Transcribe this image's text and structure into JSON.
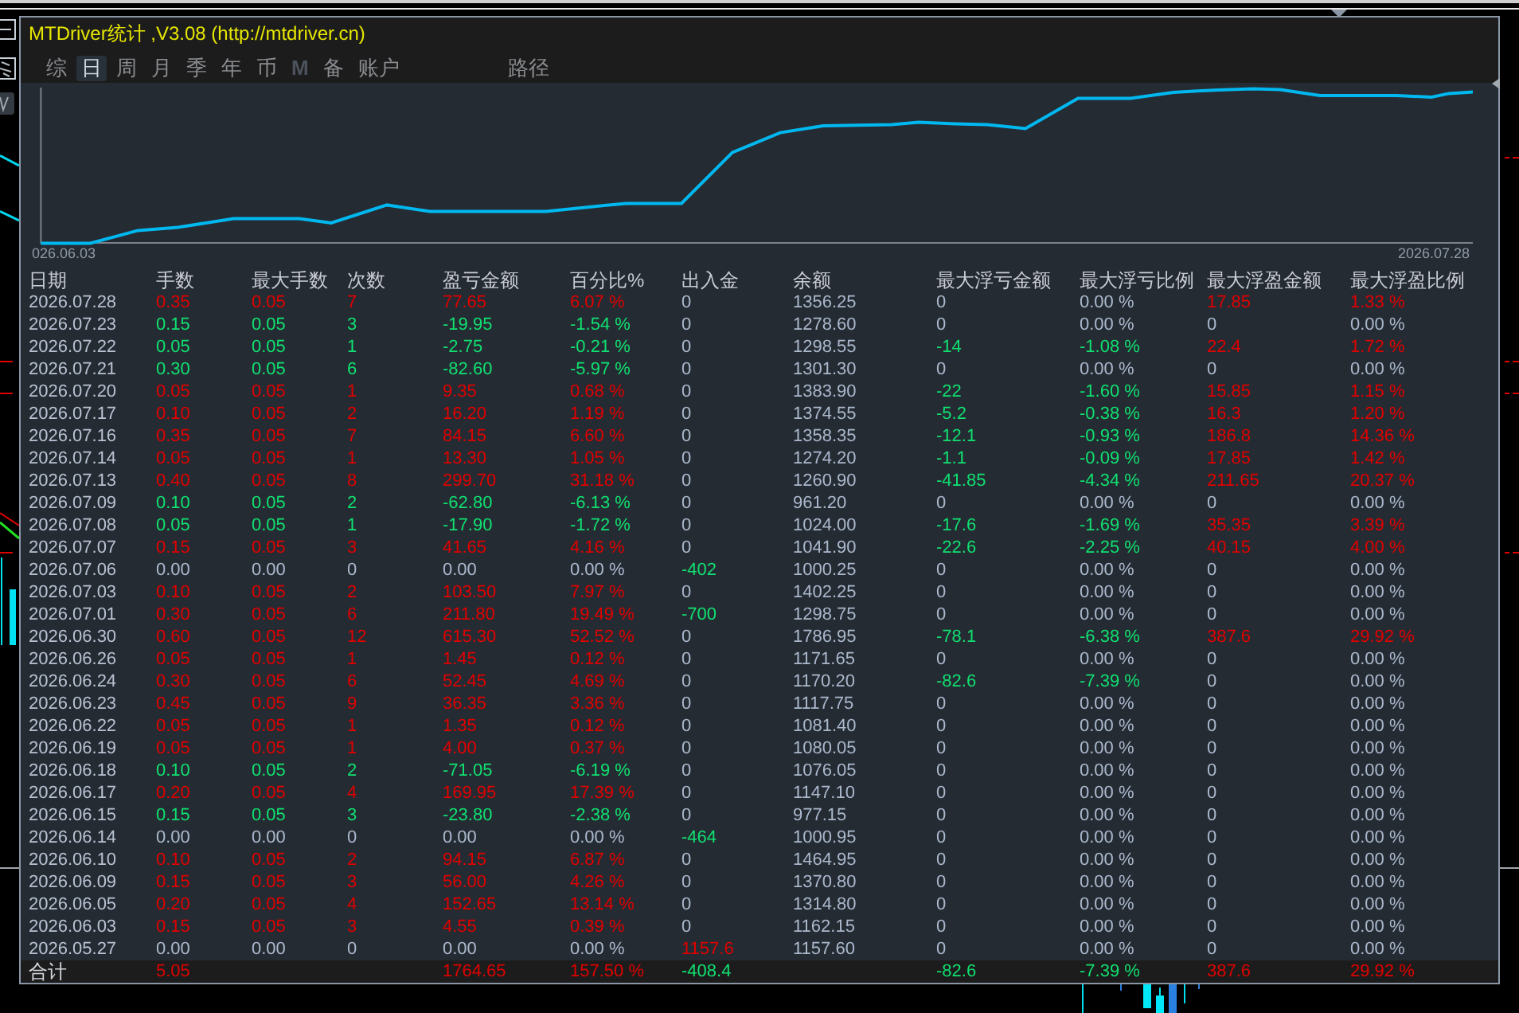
{
  "window": {
    "title": "MTDriver统计 ,V3.08 (http://mtdriver.cn)"
  },
  "tabs": [
    {
      "label": "综",
      "selected": false,
      "disabled": false
    },
    {
      "label": "日",
      "selected": true,
      "disabled": false
    },
    {
      "label": "周",
      "selected": false,
      "disabled": false
    },
    {
      "label": "月",
      "selected": false,
      "disabled": false
    },
    {
      "label": "季",
      "selected": false,
      "disabled": false
    },
    {
      "label": "年",
      "selected": false,
      "disabled": false
    },
    {
      "label": "币",
      "selected": false,
      "disabled": false
    },
    {
      "label": "M",
      "selected": false,
      "disabled": true
    },
    {
      "label": "备",
      "selected": false,
      "disabled": false
    },
    {
      "label": "账户",
      "selected": false,
      "disabled": false
    }
  ],
  "path_tab": {
    "label": "路径"
  },
  "chart": {
    "x_start_label": "026.06.03",
    "x_end_label": "2026.07.28"
  },
  "table": {
    "columns": [
      "日期",
      "手数",
      "最大手数",
      "次数",
      "盈亏金额",
      "百分比%",
      "出入金",
      "余额",
      "最大浮亏金额",
      "最大浮亏比例",
      "最大浮盈金额",
      "最大浮盈比例"
    ],
    "rows": [
      {
        "cells": [
          {
            "text": "2026.07.28",
            "color": "#b8c2d2"
          },
          {
            "text": "0.35",
            "color": "#e00000"
          },
          {
            "text": "0.05",
            "color": "#e00000"
          },
          {
            "text": "7",
            "color": "#e00000"
          },
          {
            "text": "77.65",
            "color": "#e00000"
          },
          {
            "text": "6.07 %",
            "color": "#e00000"
          },
          {
            "text": "0",
            "color": "#aab8cc"
          },
          {
            "text": "1356.25",
            "color": "#aab8cc"
          },
          {
            "text": "0",
            "color": "#aab8cc"
          },
          {
            "text": "0.00 %",
            "color": "#aab8cc"
          },
          {
            "text": "17.85",
            "color": "#e00000"
          },
          {
            "text": "1.33 %",
            "color": "#e00000"
          }
        ]
      },
      {
        "cells": [
          {
            "text": "2026.07.23",
            "color": "#b8c2d2"
          },
          {
            "text": "0.15",
            "color": "#10e070"
          },
          {
            "text": "0.05",
            "color": "#10e070"
          },
          {
            "text": "3",
            "color": "#10e070"
          },
          {
            "text": "-19.95",
            "color": "#10e070"
          },
          {
            "text": "-1.54 %",
            "color": "#10e070"
          },
          {
            "text": "0",
            "color": "#aab8cc"
          },
          {
            "text": "1278.60",
            "color": "#aab8cc"
          },
          {
            "text": "0",
            "color": "#aab8cc"
          },
          {
            "text": "0.00 %",
            "color": "#aab8cc"
          },
          {
            "text": "0",
            "color": "#aab8cc"
          },
          {
            "text": "0.00 %",
            "color": "#aab8cc"
          }
        ]
      },
      {
        "cells": [
          {
            "text": "2026.07.22",
            "color": "#b8c2d2"
          },
          {
            "text": "0.05",
            "color": "#10e070"
          },
          {
            "text": "0.05",
            "color": "#10e070"
          },
          {
            "text": "1",
            "color": "#10e070"
          },
          {
            "text": "-2.75",
            "color": "#10e070"
          },
          {
            "text": "-0.21 %",
            "color": "#10e070"
          },
          {
            "text": "0",
            "color": "#aab8cc"
          },
          {
            "text": "1298.55",
            "color": "#aab8cc"
          },
          {
            "text": "-14",
            "color": "#10e070"
          },
          {
            "text": "-1.08 %",
            "color": "#10e070"
          },
          {
            "text": "22.4",
            "color": "#e00000"
          },
          {
            "text": "1.72 %",
            "color": "#e00000"
          }
        ]
      },
      {
        "cells": [
          {
            "text": "2026.07.21",
            "color": "#b8c2d2"
          },
          {
            "text": "0.30",
            "color": "#10e070"
          },
          {
            "text": "0.05",
            "color": "#10e070"
          },
          {
            "text": "6",
            "color": "#10e070"
          },
          {
            "text": "-82.60",
            "color": "#10e070"
          },
          {
            "text": "-5.97 %",
            "color": "#10e070"
          },
          {
            "text": "0",
            "color": "#aab8cc"
          },
          {
            "text": "1301.30",
            "color": "#aab8cc"
          },
          {
            "text": "0",
            "color": "#aab8cc"
          },
          {
            "text": "0.00 %",
            "color": "#aab8cc"
          },
          {
            "text": "0",
            "color": "#aab8cc"
          },
          {
            "text": "0.00 %",
            "color": "#aab8cc"
          }
        ]
      },
      {
        "cells": [
          {
            "text": "2026.07.20",
            "color": "#b8c2d2"
          },
          {
            "text": "0.05",
            "color": "#e00000"
          },
          {
            "text": "0.05",
            "color": "#e00000"
          },
          {
            "text": "1",
            "color": "#e00000"
          },
          {
            "text": "9.35",
            "color": "#e00000"
          },
          {
            "text": "0.68 %",
            "color": "#e00000"
          },
          {
            "text": "0",
            "color": "#aab8cc"
          },
          {
            "text": "1383.90",
            "color": "#aab8cc"
          },
          {
            "text": "-22",
            "color": "#10e070"
          },
          {
            "text": "-1.60 %",
            "color": "#10e070"
          },
          {
            "text": "15.85",
            "color": "#e00000"
          },
          {
            "text": "1.15 %",
            "color": "#e00000"
          }
        ]
      },
      {
        "cells": [
          {
            "text": "2026.07.17",
            "color": "#b8c2d2"
          },
          {
            "text": "0.10",
            "color": "#e00000"
          },
          {
            "text": "0.05",
            "color": "#e00000"
          },
          {
            "text": "2",
            "color": "#e00000"
          },
          {
            "text": "16.20",
            "color": "#e00000"
          },
          {
            "text": "1.19 %",
            "color": "#e00000"
          },
          {
            "text": "0",
            "color": "#aab8cc"
          },
          {
            "text": "1374.55",
            "color": "#aab8cc"
          },
          {
            "text": "-5.2",
            "color": "#10e070"
          },
          {
            "text": "-0.38 %",
            "color": "#10e070"
          },
          {
            "text": "16.3",
            "color": "#e00000"
          },
          {
            "text": "1.20 %",
            "color": "#e00000"
          }
        ]
      },
      {
        "cells": [
          {
            "text": "2026.07.16",
            "color": "#b8c2d2"
          },
          {
            "text": "0.35",
            "color": "#e00000"
          },
          {
            "text": "0.05",
            "color": "#e00000"
          },
          {
            "text": "7",
            "color": "#e00000"
          },
          {
            "text": "84.15",
            "color": "#e00000"
          },
          {
            "text": "6.60 %",
            "color": "#e00000"
          },
          {
            "text": "0",
            "color": "#aab8cc"
          },
          {
            "text": "1358.35",
            "color": "#aab8cc"
          },
          {
            "text": "-12.1",
            "color": "#10e070"
          },
          {
            "text": "-0.93 %",
            "color": "#10e070"
          },
          {
            "text": "186.8",
            "color": "#e00000"
          },
          {
            "text": "14.36 %",
            "color": "#e00000"
          }
        ]
      },
      {
        "cells": [
          {
            "text": "2026.07.14",
            "color": "#b8c2d2"
          },
          {
            "text": "0.05",
            "color": "#e00000"
          },
          {
            "text": "0.05",
            "color": "#e00000"
          },
          {
            "text": "1",
            "color": "#e00000"
          },
          {
            "text": "13.30",
            "color": "#e00000"
          },
          {
            "text": "1.05 %",
            "color": "#e00000"
          },
          {
            "text": "0",
            "color": "#aab8cc"
          },
          {
            "text": "1274.20",
            "color": "#aab8cc"
          },
          {
            "text": "-1.1",
            "color": "#10e070"
          },
          {
            "text": "-0.09 %",
            "color": "#10e070"
          },
          {
            "text": "17.85",
            "color": "#e00000"
          },
          {
            "text": "1.42 %",
            "color": "#e00000"
          }
        ]
      },
      {
        "cells": [
          {
            "text": "2026.07.13",
            "color": "#b8c2d2"
          },
          {
            "text": "0.40",
            "color": "#e00000"
          },
          {
            "text": "0.05",
            "color": "#e00000"
          },
          {
            "text": "8",
            "color": "#e00000"
          },
          {
            "text": "299.70",
            "color": "#e00000"
          },
          {
            "text": "31.18 %",
            "color": "#e00000"
          },
          {
            "text": "0",
            "color": "#aab8cc"
          },
          {
            "text": "1260.90",
            "color": "#aab8cc"
          },
          {
            "text": "-41.85",
            "color": "#10e070"
          },
          {
            "text": "-4.34 %",
            "color": "#10e070"
          },
          {
            "text": "211.65",
            "color": "#e00000"
          },
          {
            "text": "20.37 %",
            "color": "#e00000"
          }
        ]
      },
      {
        "cells": [
          {
            "text": "2026.07.09",
            "color": "#b8c2d2"
          },
          {
            "text": "0.10",
            "color": "#10e070"
          },
          {
            "text": "0.05",
            "color": "#10e070"
          },
          {
            "text": "2",
            "color": "#10e070"
          },
          {
            "text": "-62.80",
            "color": "#10e070"
          },
          {
            "text": "-6.13 %",
            "color": "#10e070"
          },
          {
            "text": "0",
            "color": "#aab8cc"
          },
          {
            "text": "961.20",
            "color": "#aab8cc"
          },
          {
            "text": "0",
            "color": "#aab8cc"
          },
          {
            "text": "0.00 %",
            "color": "#aab8cc"
          },
          {
            "text": "0",
            "color": "#aab8cc"
          },
          {
            "text": "0.00 %",
            "color": "#aab8cc"
          }
        ]
      },
      {
        "cells": [
          {
            "text": "2026.07.08",
            "color": "#b8c2d2"
          },
          {
            "text": "0.05",
            "color": "#10e070"
          },
          {
            "text": "0.05",
            "color": "#10e070"
          },
          {
            "text": "1",
            "color": "#10e070"
          },
          {
            "text": "-17.90",
            "color": "#10e070"
          },
          {
            "text": "-1.72 %",
            "color": "#10e070"
          },
          {
            "text": "0",
            "color": "#aab8cc"
          },
          {
            "text": "1024.00",
            "color": "#aab8cc"
          },
          {
            "text": "-17.6",
            "color": "#10e070"
          },
          {
            "text": "-1.69 %",
            "color": "#10e070"
          },
          {
            "text": "35.35",
            "color": "#e00000"
          },
          {
            "text": "3.39 %",
            "color": "#e00000"
          }
        ]
      },
      {
        "cells": [
          {
            "text": "2026.07.07",
            "color": "#b8c2d2"
          },
          {
            "text": "0.15",
            "color": "#e00000"
          },
          {
            "text": "0.05",
            "color": "#e00000"
          },
          {
            "text": "3",
            "color": "#e00000"
          },
          {
            "text": "41.65",
            "color": "#e00000"
          },
          {
            "text": "4.16 %",
            "color": "#e00000"
          },
          {
            "text": "0",
            "color": "#aab8cc"
          },
          {
            "text": "1041.90",
            "color": "#aab8cc"
          },
          {
            "text": "-22.6",
            "color": "#10e070"
          },
          {
            "text": "-2.25 %",
            "color": "#10e070"
          },
          {
            "text": "40.15",
            "color": "#e00000"
          },
          {
            "text": "4.00 %",
            "color": "#e00000"
          }
        ]
      },
      {
        "cells": [
          {
            "text": "2026.07.06",
            "color": "#b8c2d2"
          },
          {
            "text": "0.00",
            "color": "#aab8cc"
          },
          {
            "text": "0.00",
            "color": "#aab8cc"
          },
          {
            "text": "0",
            "color": "#aab8cc"
          },
          {
            "text": "0.00",
            "color": "#aab8cc"
          },
          {
            "text": "0.00 %",
            "color": "#aab8cc"
          },
          {
            "text": "-402",
            "color": "#10e070"
          },
          {
            "text": "1000.25",
            "color": "#aab8cc"
          },
          {
            "text": "0",
            "color": "#aab8cc"
          },
          {
            "text": "0.00 %",
            "color": "#aab8cc"
          },
          {
            "text": "0",
            "color": "#aab8cc"
          },
          {
            "text": "0.00 %",
            "color": "#aab8cc"
          }
        ]
      },
      {
        "cells": [
          {
            "text": "2026.07.03",
            "color": "#b8c2d2"
          },
          {
            "text": "0.10",
            "color": "#e00000"
          },
          {
            "text": "0.05",
            "color": "#e00000"
          },
          {
            "text": "2",
            "color": "#e00000"
          },
          {
            "text": "103.50",
            "color": "#e00000"
          },
          {
            "text": "7.97 %",
            "color": "#e00000"
          },
          {
            "text": "0",
            "color": "#aab8cc"
          },
          {
            "text": "1402.25",
            "color": "#aab8cc"
          },
          {
            "text": "0",
            "color": "#aab8cc"
          },
          {
            "text": "0.00 %",
            "color": "#aab8cc"
          },
          {
            "text": "0",
            "color": "#aab8cc"
          },
          {
            "text": "0.00 %",
            "color": "#aab8cc"
          }
        ]
      },
      {
        "cells": [
          {
            "text": "2026.07.01",
            "color": "#b8c2d2"
          },
          {
            "text": "0.30",
            "color": "#e00000"
          },
          {
            "text": "0.05",
            "color": "#e00000"
          },
          {
            "text": "6",
            "color": "#e00000"
          },
          {
            "text": "211.80",
            "color": "#e00000"
          },
          {
            "text": "19.49 %",
            "color": "#e00000"
          },
          {
            "text": "-700",
            "color": "#10e070"
          },
          {
            "text": "1298.75",
            "color": "#aab8cc"
          },
          {
            "text": "0",
            "color": "#aab8cc"
          },
          {
            "text": "0.00 %",
            "color": "#aab8cc"
          },
          {
            "text": "0",
            "color": "#aab8cc"
          },
          {
            "text": "0.00 %",
            "color": "#aab8cc"
          }
        ]
      },
      {
        "cells": [
          {
            "text": "2026.06.30",
            "color": "#b8c2d2"
          },
          {
            "text": "0.60",
            "color": "#e00000"
          },
          {
            "text": "0.05",
            "color": "#e00000"
          },
          {
            "text": "12",
            "color": "#e00000"
          },
          {
            "text": "615.30",
            "color": "#e00000"
          },
          {
            "text": "52.52 %",
            "color": "#e00000"
          },
          {
            "text": "0",
            "color": "#aab8cc"
          },
          {
            "text": "1786.95",
            "color": "#aab8cc"
          },
          {
            "text": "-78.1",
            "color": "#10e070"
          },
          {
            "text": "-6.38 %",
            "color": "#10e070"
          },
          {
            "text": "387.6",
            "color": "#e00000"
          },
          {
            "text": "29.92 %",
            "color": "#e00000"
          }
        ]
      },
      {
        "cells": [
          {
            "text": "2026.06.26",
            "color": "#b8c2d2"
          },
          {
            "text": "0.05",
            "color": "#e00000"
          },
          {
            "text": "0.05",
            "color": "#e00000"
          },
          {
            "text": "1",
            "color": "#e00000"
          },
          {
            "text": "1.45",
            "color": "#e00000"
          },
          {
            "text": "0.12 %",
            "color": "#e00000"
          },
          {
            "text": "0",
            "color": "#aab8cc"
          },
          {
            "text": "1171.65",
            "color": "#aab8cc"
          },
          {
            "text": "0",
            "color": "#aab8cc"
          },
          {
            "text": "0.00 %",
            "color": "#aab8cc"
          },
          {
            "text": "0",
            "color": "#aab8cc"
          },
          {
            "text": "0.00 %",
            "color": "#aab8cc"
          }
        ]
      },
      {
        "cells": [
          {
            "text": "2026.06.24",
            "color": "#b8c2d2"
          },
          {
            "text": "0.30",
            "color": "#e00000"
          },
          {
            "text": "0.05",
            "color": "#e00000"
          },
          {
            "text": "6",
            "color": "#e00000"
          },
          {
            "text": "52.45",
            "color": "#e00000"
          },
          {
            "text": "4.69 %",
            "color": "#e00000"
          },
          {
            "text": "0",
            "color": "#aab8cc"
          },
          {
            "text": "1170.20",
            "color": "#aab8cc"
          },
          {
            "text": "-82.6",
            "color": "#10e070"
          },
          {
            "text": "-7.39 %",
            "color": "#10e070"
          },
          {
            "text": "0",
            "color": "#aab8cc"
          },
          {
            "text": "0.00 %",
            "color": "#aab8cc"
          }
        ]
      },
      {
        "cells": [
          {
            "text": "2026.06.23",
            "color": "#b8c2d2"
          },
          {
            "text": "0.45",
            "color": "#e00000"
          },
          {
            "text": "0.05",
            "color": "#e00000"
          },
          {
            "text": "9",
            "color": "#e00000"
          },
          {
            "text": "36.35",
            "color": "#e00000"
          },
          {
            "text": "3.36 %",
            "color": "#e00000"
          },
          {
            "text": "0",
            "color": "#aab8cc"
          },
          {
            "text": "1117.75",
            "color": "#aab8cc"
          },
          {
            "text": "0",
            "color": "#aab8cc"
          },
          {
            "text": "0.00 %",
            "color": "#aab8cc"
          },
          {
            "text": "0",
            "color": "#aab8cc"
          },
          {
            "text": "0.00 %",
            "color": "#aab8cc"
          }
        ]
      },
      {
        "cells": [
          {
            "text": "2026.06.22",
            "color": "#b8c2d2"
          },
          {
            "text": "0.05",
            "color": "#e00000"
          },
          {
            "text": "0.05",
            "color": "#e00000"
          },
          {
            "text": "1",
            "color": "#e00000"
          },
          {
            "text": "1.35",
            "color": "#e00000"
          },
          {
            "text": "0.12 %",
            "color": "#e00000"
          },
          {
            "text": "0",
            "color": "#aab8cc"
          },
          {
            "text": "1081.40",
            "color": "#aab8cc"
          },
          {
            "text": "0",
            "color": "#aab8cc"
          },
          {
            "text": "0.00 %",
            "color": "#aab8cc"
          },
          {
            "text": "0",
            "color": "#aab8cc"
          },
          {
            "text": "0.00 %",
            "color": "#aab8cc"
          }
        ]
      },
      {
        "cells": [
          {
            "text": "2026.06.19",
            "color": "#b8c2d2"
          },
          {
            "text": "0.05",
            "color": "#e00000"
          },
          {
            "text": "0.05",
            "color": "#e00000"
          },
          {
            "text": "1",
            "color": "#e00000"
          },
          {
            "text": "4.00",
            "color": "#e00000"
          },
          {
            "text": "0.37 %",
            "color": "#e00000"
          },
          {
            "text": "0",
            "color": "#aab8cc"
          },
          {
            "text": "1080.05",
            "color": "#aab8cc"
          },
          {
            "text": "0",
            "color": "#aab8cc"
          },
          {
            "text": "0.00 %",
            "color": "#aab8cc"
          },
          {
            "text": "0",
            "color": "#aab8cc"
          },
          {
            "text": "0.00 %",
            "color": "#aab8cc"
          }
        ]
      },
      {
        "cells": [
          {
            "text": "2026.06.18",
            "color": "#b8c2d2"
          },
          {
            "text": "0.10",
            "color": "#10e070"
          },
          {
            "text": "0.05",
            "color": "#10e070"
          },
          {
            "text": "2",
            "color": "#10e070"
          },
          {
            "text": "-71.05",
            "color": "#10e070"
          },
          {
            "text": "-6.19 %",
            "color": "#10e070"
          },
          {
            "text": "0",
            "color": "#aab8cc"
          },
          {
            "text": "1076.05",
            "color": "#aab8cc"
          },
          {
            "text": "0",
            "color": "#aab8cc"
          },
          {
            "text": "0.00 %",
            "color": "#aab8cc"
          },
          {
            "text": "0",
            "color": "#aab8cc"
          },
          {
            "text": "0.00 %",
            "color": "#aab8cc"
          }
        ]
      },
      {
        "cells": [
          {
            "text": "2026.06.17",
            "color": "#b8c2d2"
          },
          {
            "text": "0.20",
            "color": "#e00000"
          },
          {
            "text": "0.05",
            "color": "#e00000"
          },
          {
            "text": "4",
            "color": "#e00000"
          },
          {
            "text": "169.95",
            "color": "#e00000"
          },
          {
            "text": "17.39 %",
            "color": "#e00000"
          },
          {
            "text": "0",
            "color": "#aab8cc"
          },
          {
            "text": "1147.10",
            "color": "#aab8cc"
          },
          {
            "text": "0",
            "color": "#aab8cc"
          },
          {
            "text": "0.00 %",
            "color": "#aab8cc"
          },
          {
            "text": "0",
            "color": "#aab8cc"
          },
          {
            "text": "0.00 %",
            "color": "#aab8cc"
          }
        ]
      },
      {
        "cells": [
          {
            "text": "2026.06.15",
            "color": "#b8c2d2"
          },
          {
            "text": "0.15",
            "color": "#10e070"
          },
          {
            "text": "0.05",
            "color": "#10e070"
          },
          {
            "text": "3",
            "color": "#10e070"
          },
          {
            "text": "-23.80",
            "color": "#10e070"
          },
          {
            "text": "-2.38 %",
            "color": "#10e070"
          },
          {
            "text": "0",
            "color": "#aab8cc"
          },
          {
            "text": "977.15",
            "color": "#aab8cc"
          },
          {
            "text": "0",
            "color": "#aab8cc"
          },
          {
            "text": "0.00 %",
            "color": "#aab8cc"
          },
          {
            "text": "0",
            "color": "#aab8cc"
          },
          {
            "text": "0.00 %",
            "color": "#aab8cc"
          }
        ]
      },
      {
        "cells": [
          {
            "text": "2026.06.14",
            "color": "#b8c2d2"
          },
          {
            "text": "0.00",
            "color": "#aab8cc"
          },
          {
            "text": "0.00",
            "color": "#aab8cc"
          },
          {
            "text": "0",
            "color": "#aab8cc"
          },
          {
            "text": "0.00",
            "color": "#aab8cc"
          },
          {
            "text": "0.00 %",
            "color": "#aab8cc"
          },
          {
            "text": "-464",
            "color": "#10e070"
          },
          {
            "text": "1000.95",
            "color": "#aab8cc"
          },
          {
            "text": "0",
            "color": "#aab8cc"
          },
          {
            "text": "0.00 %",
            "color": "#aab8cc"
          },
          {
            "text": "0",
            "color": "#aab8cc"
          },
          {
            "text": "0.00 %",
            "color": "#aab8cc"
          }
        ]
      },
      {
        "cells": [
          {
            "text": "2026.06.10",
            "color": "#b8c2d2"
          },
          {
            "text": "0.10",
            "color": "#e00000"
          },
          {
            "text": "0.05",
            "color": "#e00000"
          },
          {
            "text": "2",
            "color": "#e00000"
          },
          {
            "text": "94.15",
            "color": "#e00000"
          },
          {
            "text": "6.87 %",
            "color": "#e00000"
          },
          {
            "text": "0",
            "color": "#aab8cc"
          },
          {
            "text": "1464.95",
            "color": "#aab8cc"
          },
          {
            "text": "0",
            "color": "#aab8cc"
          },
          {
            "text": "0.00 %",
            "color": "#aab8cc"
          },
          {
            "text": "0",
            "color": "#aab8cc"
          },
          {
            "text": "0.00 %",
            "color": "#aab8cc"
          }
        ]
      },
      {
        "cells": [
          {
            "text": "2026.06.09",
            "color": "#b8c2d2"
          },
          {
            "text": "0.15",
            "color": "#e00000"
          },
          {
            "text": "0.05",
            "color": "#e00000"
          },
          {
            "text": "3",
            "color": "#e00000"
          },
          {
            "text": "56.00",
            "color": "#e00000"
          },
          {
            "text": "4.26 %",
            "color": "#e00000"
          },
          {
            "text": "0",
            "color": "#aab8cc"
          },
          {
            "text": "1370.80",
            "color": "#aab8cc"
          },
          {
            "text": "0",
            "color": "#aab8cc"
          },
          {
            "text": "0.00 %",
            "color": "#aab8cc"
          },
          {
            "text": "0",
            "color": "#aab8cc"
          },
          {
            "text": "0.00 %",
            "color": "#aab8cc"
          }
        ]
      },
      {
        "cells": [
          {
            "text": "2026.06.05",
            "color": "#b8c2d2"
          },
          {
            "text": "0.20",
            "color": "#e00000"
          },
          {
            "text": "0.05",
            "color": "#e00000"
          },
          {
            "text": "4",
            "color": "#e00000"
          },
          {
            "text": "152.65",
            "color": "#e00000"
          },
          {
            "text": "13.14 %",
            "color": "#e00000"
          },
          {
            "text": "0",
            "color": "#aab8cc"
          },
          {
            "text": "1314.80",
            "color": "#aab8cc"
          },
          {
            "text": "0",
            "color": "#aab8cc"
          },
          {
            "text": "0.00 %",
            "color": "#aab8cc"
          },
          {
            "text": "0",
            "color": "#aab8cc"
          },
          {
            "text": "0.00 %",
            "color": "#aab8cc"
          }
        ]
      },
      {
        "cells": [
          {
            "text": "2026.06.03",
            "color": "#b8c2d2"
          },
          {
            "text": "0.15",
            "color": "#e00000"
          },
          {
            "text": "0.05",
            "color": "#e00000"
          },
          {
            "text": "3",
            "color": "#e00000"
          },
          {
            "text": "4.55",
            "color": "#e00000"
          },
          {
            "text": "0.39 %",
            "color": "#e00000"
          },
          {
            "text": "0",
            "color": "#aab8cc"
          },
          {
            "text": "1162.15",
            "color": "#aab8cc"
          },
          {
            "text": "0",
            "color": "#aab8cc"
          },
          {
            "text": "0.00 %",
            "color": "#aab8cc"
          },
          {
            "text": "0",
            "color": "#aab8cc"
          },
          {
            "text": "0.00 %",
            "color": "#aab8cc"
          }
        ]
      },
      {
        "cells": [
          {
            "text": "2026.05.27",
            "color": "#b8c2d2"
          },
          {
            "text": "0.00",
            "color": "#aab8cc"
          },
          {
            "text": "0.00",
            "color": "#aab8cc"
          },
          {
            "text": "0",
            "color": "#aab8cc"
          },
          {
            "text": "0.00",
            "color": "#aab8cc"
          },
          {
            "text": "0.00 %",
            "color": "#aab8cc"
          },
          {
            "text": "1157.6",
            "color": "#e00000"
          },
          {
            "text": "1157.60",
            "color": "#aab8cc"
          },
          {
            "text": "0",
            "color": "#aab8cc"
          },
          {
            "text": "0.00 %",
            "color": "#aab8cc"
          },
          {
            "text": "0",
            "color": "#aab8cc"
          },
          {
            "text": "0.00 %",
            "color": "#aab8cc"
          }
        ]
      }
    ],
    "totals": {
      "cells": [
        {
          "text": "合计",
          "color": "#d4d8dc"
        },
        {
          "text": "5.05",
          "color": "#e00000"
        },
        null,
        null,
        {
          "text": "1764.65",
          "color": "#e00000"
        },
        {
          "text": "157.50 %",
          "color": "#e00000"
        },
        {
          "text": "-408.4",
          "color": "#10e070"
        },
        null,
        {
          "text": "-82.6",
          "color": "#10e070"
        },
        {
          "text": "-7.39 %",
          "color": "#10e070"
        },
        {
          "text": "387.6",
          "color": "#e00000"
        },
        {
          "text": "29.92 %",
          "color": "#e00000"
        }
      ]
    }
  }
}
